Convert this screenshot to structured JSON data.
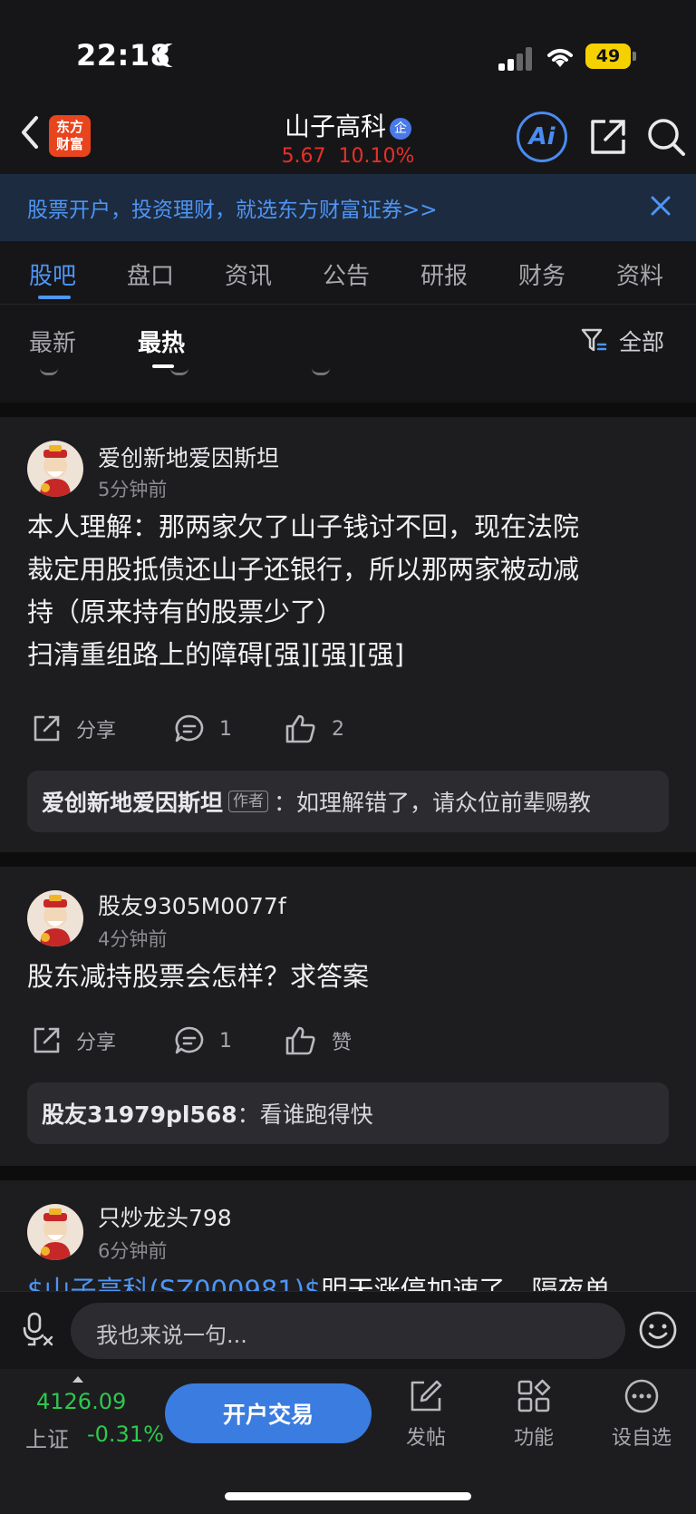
{
  "status_bar": {
    "time": "22:18",
    "battery": "49"
  },
  "header": {
    "logo_line1": "东方",
    "logo_line2": "财富",
    "stock_name": "山子高科",
    "badge": "企",
    "price": "5.67",
    "change_pct": "10.10%",
    "ai_label": "Ai"
  },
  "banner": {
    "text": "股票开户，投资理财，就选东方财富证券>>"
  },
  "tabs": [
    "股吧",
    "盘口",
    "资讯",
    "公告",
    "研报",
    "财务",
    "资料"
  ],
  "active_tab": "股吧",
  "sort": {
    "latest": "最新",
    "hottest": "最热",
    "filter_label": "全部"
  },
  "posts": [
    {
      "author": "爱创新地爱因斯坦",
      "time": "5分钟前",
      "lines": [
        "本人理解：那两家欠了山子钱讨不回，现在法院",
        "裁定用股抵债还山子还银行，所以那两家被动减",
        "持（原来持有的股票少了）",
        "扫清重组路上的障碍[强][强][强]"
      ],
      "share": "分享",
      "comments": "1",
      "likes": "2",
      "reply": {
        "user": "爱创新地爱因斯坦",
        "tag": "作者",
        "sep": "：",
        "text": "如理解错了，请众位前辈赐教"
      }
    },
    {
      "author": "股友9305M0077f",
      "time": "4分钟前",
      "lines": [
        "股东减持股票会怎样？求答案"
      ],
      "share": "分享",
      "comments": "1",
      "likes": "赞",
      "reply": {
        "user": "股友31979pl568",
        "sep": "：",
        "text": "看谁跑得快"
      }
    },
    {
      "author": "只炒龙头798",
      "time": "6分钟前",
      "link": "$山子高科(SZ000981)$",
      "text_after_link": "明天涨停加速了，隔夜单"
    }
  ],
  "input_placeholder": "我也来说一句...",
  "bottom_nav": {
    "index_value": "4126.09",
    "index_name": "上证",
    "index_change": "-0.31%",
    "trade_button": "开户交易",
    "post": "发帖",
    "functions": "功能",
    "watchlist": "设自选"
  },
  "colors": {
    "up": "#e5302a",
    "down": "#2ec84d",
    "accent": "#4e95f4"
  }
}
